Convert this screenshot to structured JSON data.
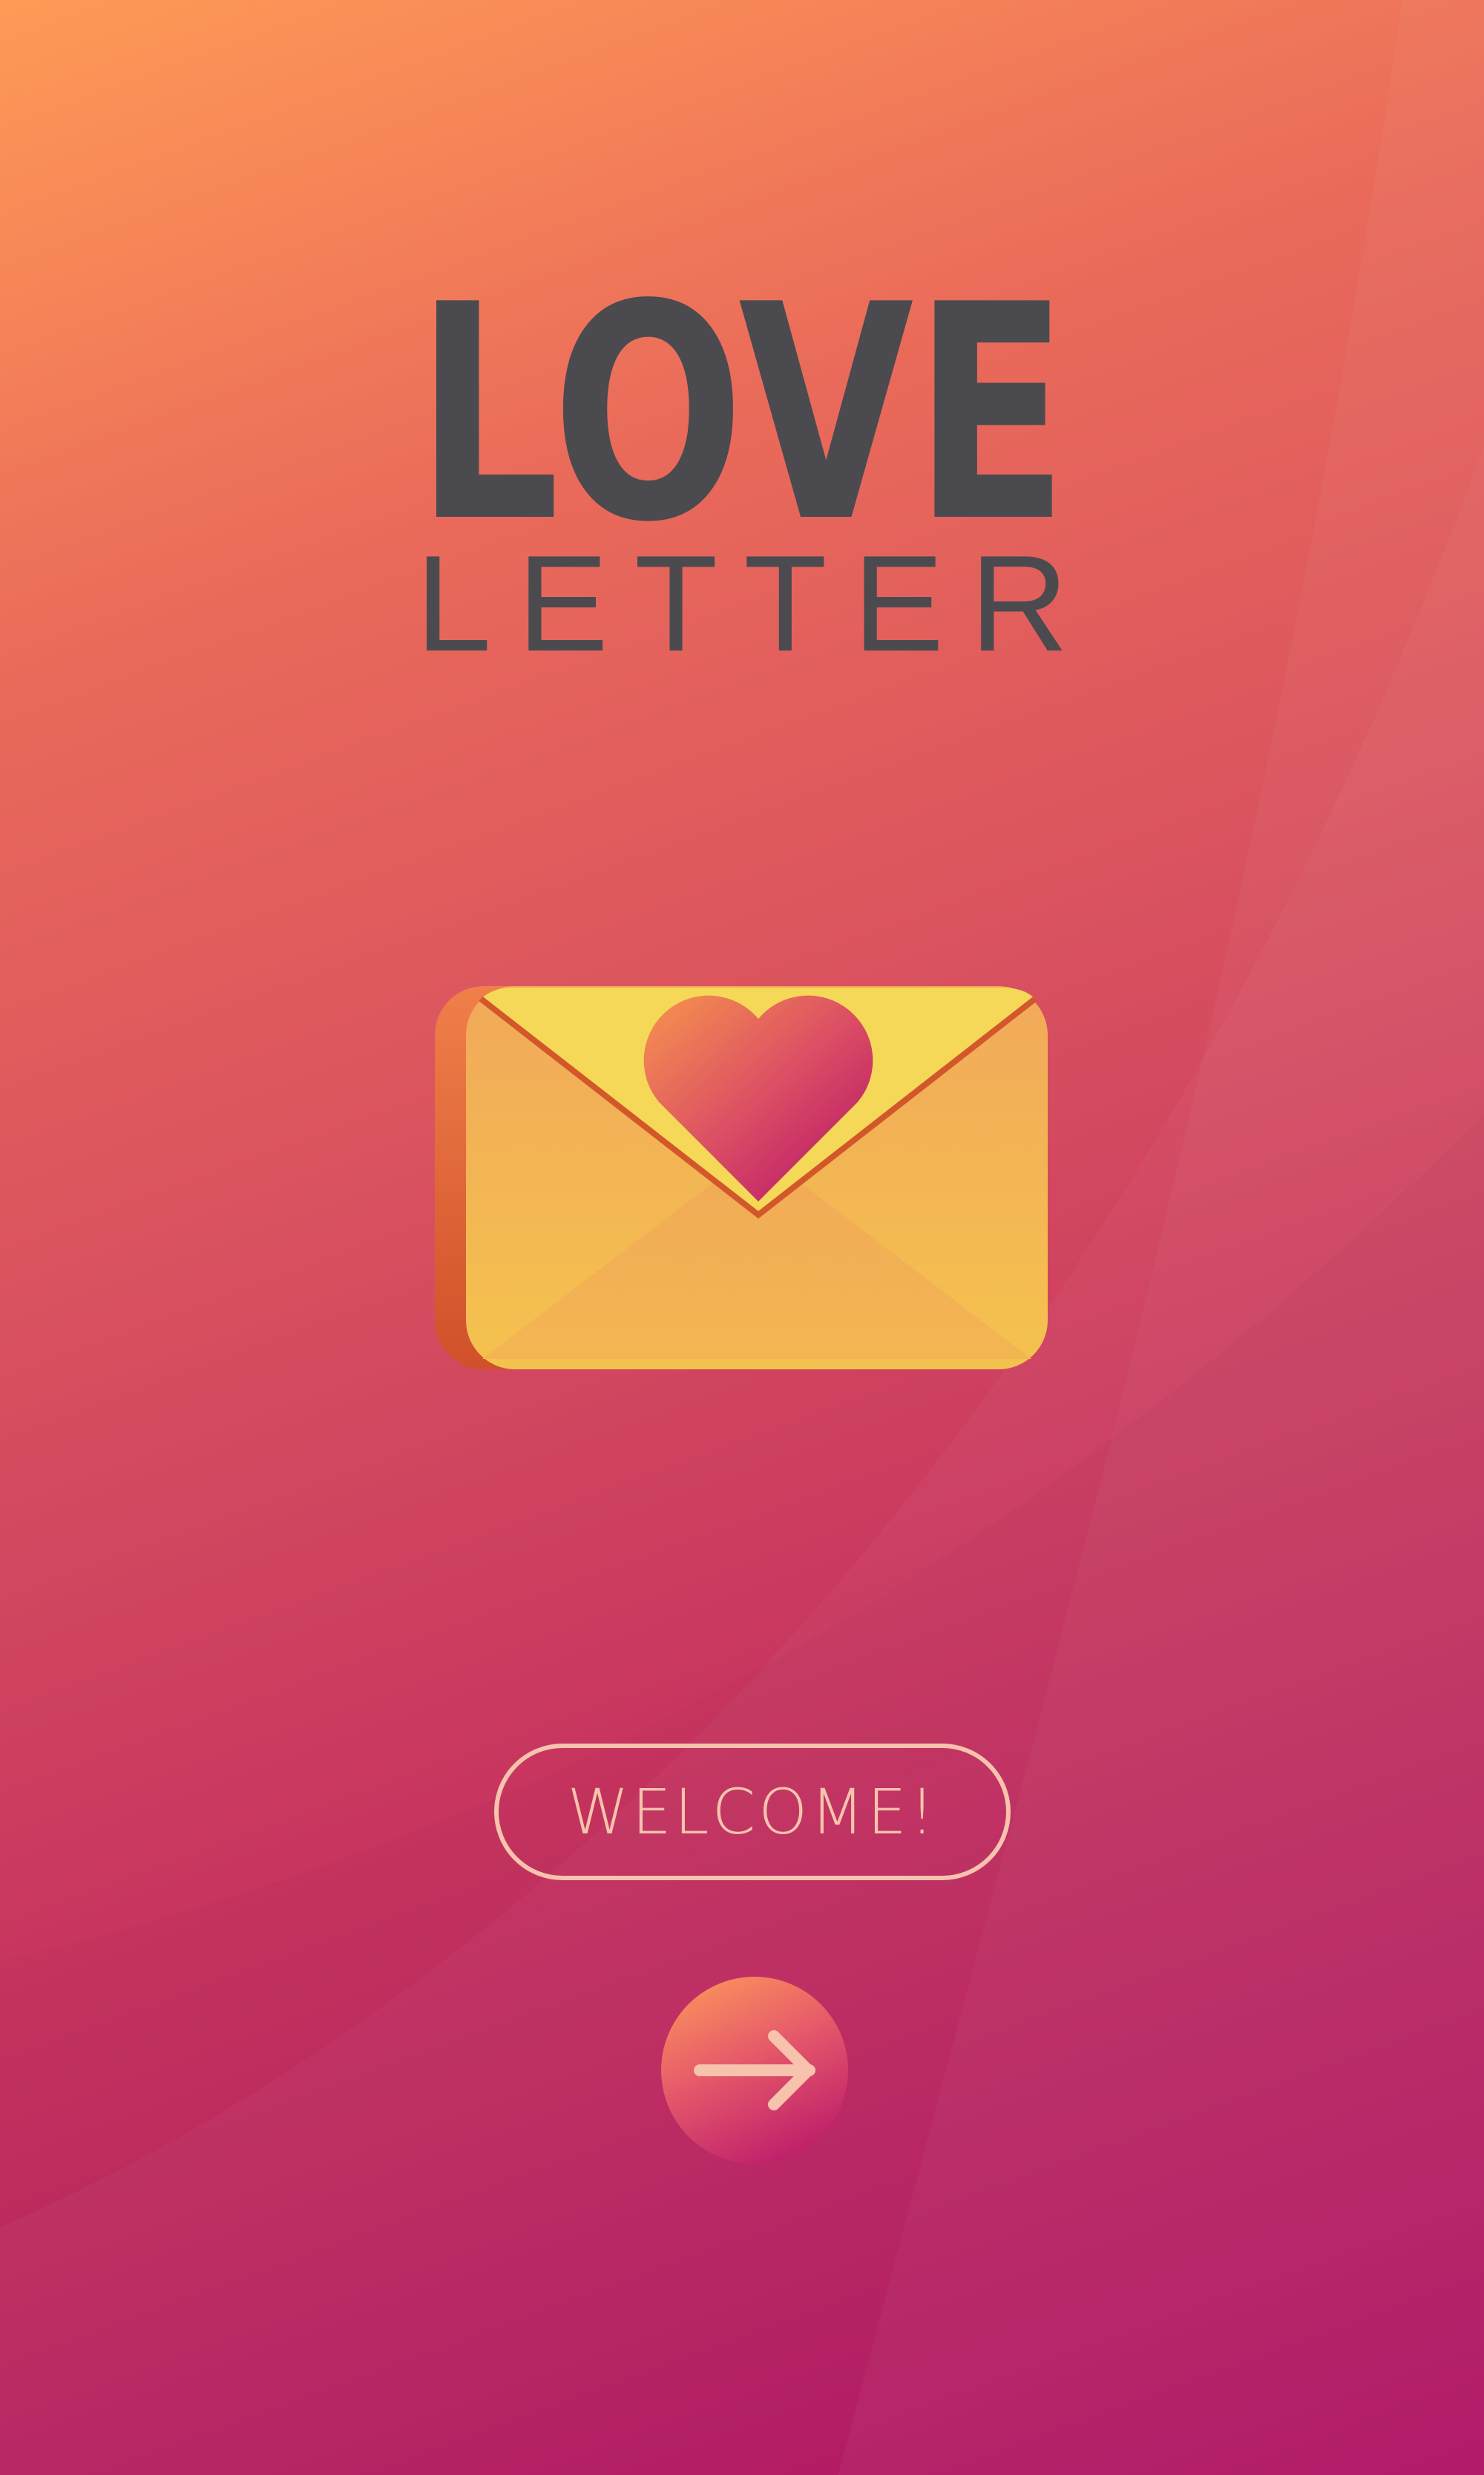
{
  "app": {
    "logo_word_1": "LOVE",
    "logo_word_2": "LETTER"
  },
  "hero": {
    "icon": "envelope-with-heart-icon"
  },
  "actions": {
    "welcome_label": "WELCOME!",
    "next_icon": "arrow-right-icon"
  },
  "colors": {
    "background_top": "#ff9a56",
    "background_bottom": "#b20c64",
    "logo_text": "#4a4a4f",
    "envelope_body": "#f3b752",
    "envelope_flap": "#f5d858",
    "envelope_edge": "#d2572a",
    "heart_top": "#f7904f",
    "heart_bottom": "#b4106a",
    "button_outline": "#f7c3ad"
  }
}
